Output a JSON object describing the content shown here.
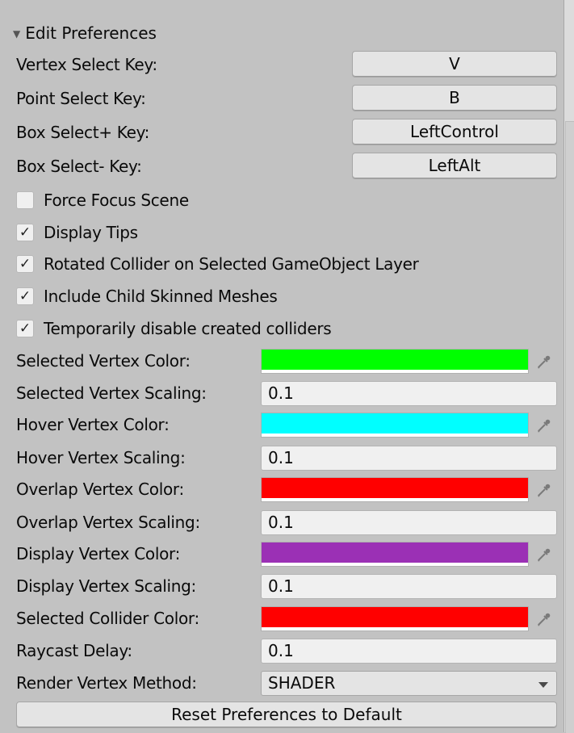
{
  "section": {
    "title": "Edit Preferences",
    "expanded": true
  },
  "keys": [
    {
      "label": "Vertex Select Key:",
      "value": "V"
    },
    {
      "label": "Point Select Key:",
      "value": "B"
    },
    {
      "label": "Box Select+ Key:",
      "value": "LeftControl"
    },
    {
      "label": "Box Select- Key:",
      "value": "LeftAlt"
    }
  ],
  "toggles": [
    {
      "label": "Force Focus Scene",
      "checked": false,
      "mark": ""
    },
    {
      "label": "Display Tips",
      "checked": true,
      "mark": "✓"
    },
    {
      "label": "Rotated Collider on Selected GameObject Layer",
      "checked": true,
      "mark": "✓"
    },
    {
      "label": "Include Child Skinned Meshes",
      "checked": true,
      "mark": "✓"
    },
    {
      "label": "Temporarily disable created colliders",
      "checked": true,
      "mark": "✓"
    }
  ],
  "fields": [
    {
      "label": "Selected Vertex Color:",
      "kind": "color",
      "color": "#00ff00"
    },
    {
      "label": "Selected Vertex Scaling:",
      "kind": "text",
      "value": "0.1"
    },
    {
      "label": "Hover Vertex Color:",
      "kind": "color",
      "color": "#00ffff"
    },
    {
      "label": "Hover Vertex Scaling:",
      "kind": "text",
      "value": "0.1"
    },
    {
      "label": "Overlap Vertex Color:",
      "kind": "color",
      "color": "#ff0000"
    },
    {
      "label": "Overlap Vertex Scaling:",
      "kind": "text",
      "value": "0.1"
    },
    {
      "label": "Display Vertex Color:",
      "kind": "color",
      "color": "#9b30b5"
    },
    {
      "label": "Display Vertex Scaling:",
      "kind": "text",
      "value": "0.1"
    },
    {
      "label": "Selected Collider Color:",
      "kind": "color",
      "color": "#ff0000"
    },
    {
      "label": "Raycast Delay:",
      "kind": "text",
      "value": "0.1"
    }
  ],
  "render_method": {
    "label": "Render Vertex Method:",
    "value": "SHADER"
  },
  "reset_button": {
    "label": "Reset Preferences to Default"
  },
  "icons": {
    "foldout": "triangle-down-icon",
    "picker": "eyedropper-icon",
    "dropdown": "chevron-down-icon"
  }
}
